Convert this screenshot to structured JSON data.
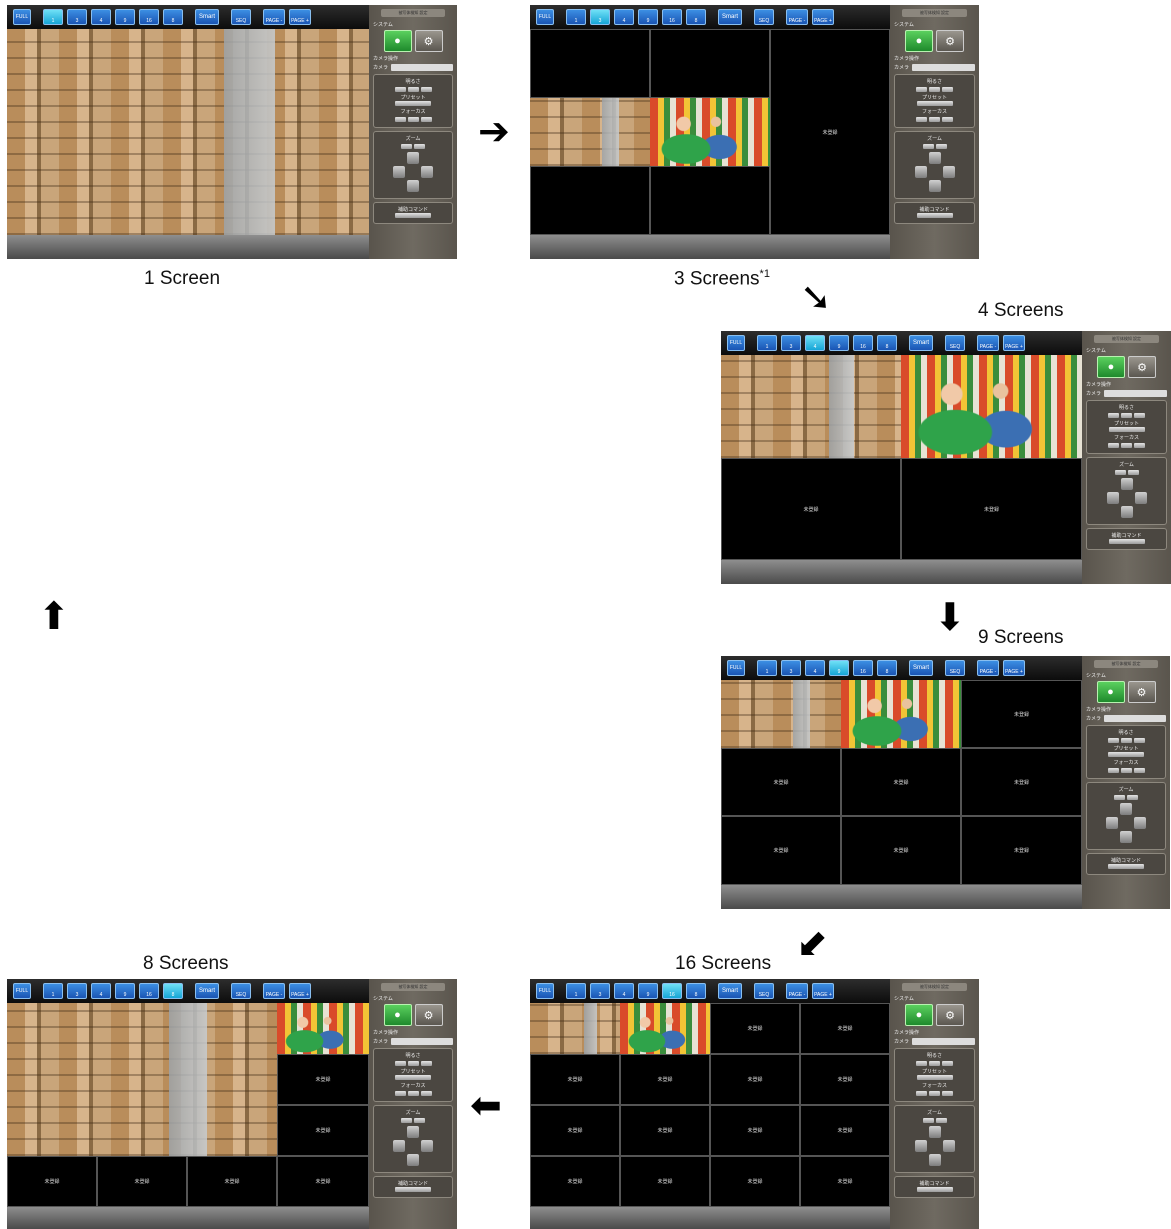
{
  "captions": {
    "one": "1 Screen",
    "three": "3 Screens",
    "three_note": "*1",
    "four": "4 Screens",
    "nine": "9 Screens",
    "sixteen": "16 Screens",
    "eight": "8 Screens"
  },
  "arrows": {
    "right": "➔",
    "down_right": "➘",
    "down": "⬇",
    "down_left": "⬋",
    "left": "⬅",
    "up": "⬆"
  },
  "toolbar": {
    "full": "FULL",
    "layouts": [
      "1",
      "3",
      "4",
      "9",
      "16",
      "8"
    ],
    "smart": "Smart",
    "seq": "SEQ",
    "page_prev": "PAGE -",
    "page_next": "PAGE +"
  },
  "panel": {
    "top_button": "被写体検知 設定",
    "system": "システム",
    "camera_ops": "カメラ操作",
    "camera": "カメラ",
    "brightness": "明るさ",
    "preset": "プリセット",
    "focus": "フォーカス",
    "zoom": "ズーム",
    "aux_command": "補助コマンド"
  },
  "cell_text": "未登録",
  "icons": {
    "operator": "person-icon",
    "settings": "gear-icon"
  }
}
